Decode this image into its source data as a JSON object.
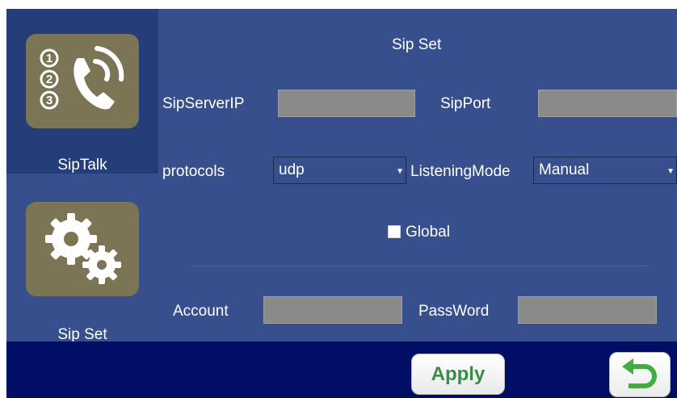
{
  "sidebar": {
    "items": [
      {
        "label": "SipTalk",
        "icon": "phone-numbers-icon",
        "active": true
      },
      {
        "label": "Sip Set",
        "icon": "gears-icon",
        "active": false
      }
    ]
  },
  "form": {
    "title": "Sip Set",
    "server_ip": {
      "label": "SipServerIP",
      "value": ""
    },
    "port": {
      "label": "SipPort",
      "value": ""
    },
    "protocols": {
      "label": "protocols",
      "value": "udp"
    },
    "listening_mode": {
      "label": "ListeningMode",
      "value": "Manual"
    },
    "global": {
      "label": "Global",
      "checked": false
    },
    "account": {
      "label": "Account",
      "value": ""
    },
    "password": {
      "label": "PassWord",
      "value": ""
    }
  },
  "footer": {
    "apply_label": "Apply",
    "back_icon": "return-arrow-icon"
  },
  "colors": {
    "background": "#374f8c",
    "sidebar_active": "#253d78",
    "bottom_bar": "#000e66",
    "tile": "#7b7556",
    "apply_text": "#3a8a48",
    "back_arrow": "#3fae3f"
  }
}
